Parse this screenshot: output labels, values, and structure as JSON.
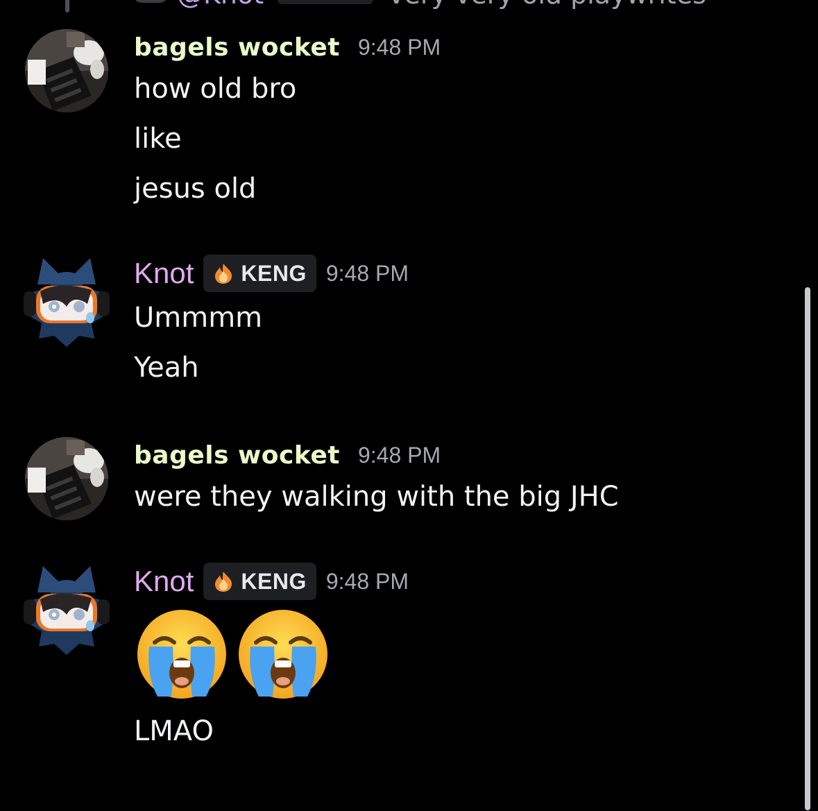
{
  "reply_preview": {
    "name": "@Knot",
    "text": "very very old playwrites"
  },
  "messages": [
    {
      "author": "bagels wocket",
      "time": "9:48 PM",
      "lines": [
        "how old bro",
        "like",
        "jesus old"
      ]
    },
    {
      "author": "Knot",
      "tag": "KENG",
      "time": "9:48 PM",
      "lines": [
        "Ummmm",
        "Yeah"
      ]
    },
    {
      "author": "bagels wocket",
      "time": "9:48 PM",
      "lines": [
        "were they walking with the big JHC"
      ]
    },
    {
      "author": "Knot",
      "tag": "KENG",
      "time": "9:48 PM",
      "emojis": [
        "loudly-crying-face",
        "loudly-crying-face"
      ],
      "lines": [
        "LMAO"
      ]
    }
  ],
  "colors": {
    "background": "#000000",
    "bagels_name": "#e9fbc8",
    "knot_name": "#e3a8f0",
    "timestamp": "#a7a9b0",
    "tag_bg": "#1e1f22"
  }
}
